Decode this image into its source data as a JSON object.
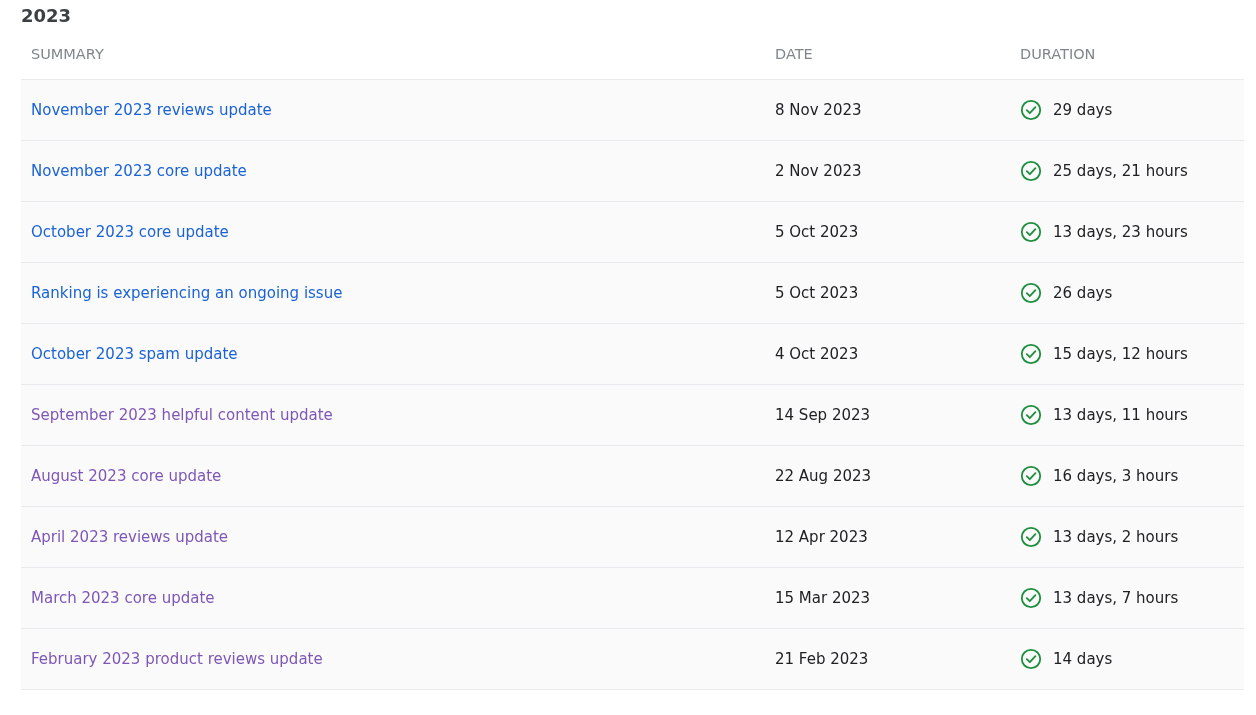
{
  "section": {
    "title": "2023"
  },
  "table": {
    "columns": [
      "SUMMARY",
      "DATE",
      "DURATION"
    ],
    "rows": [
      {
        "summary": "November 2023 reviews update",
        "visited": false,
        "date": "8 Nov 2023",
        "resolved": true,
        "duration": "29 days"
      },
      {
        "summary": "November 2023 core update",
        "visited": false,
        "date": "2 Nov 2023",
        "resolved": true,
        "duration": "25 days, 21 hours"
      },
      {
        "summary": "October 2023 core update",
        "visited": false,
        "date": "5 Oct 2023",
        "resolved": true,
        "duration": "13 days, 23 hours"
      },
      {
        "summary": "Ranking is experiencing an ongoing issue",
        "visited": false,
        "date": "5 Oct 2023",
        "resolved": true,
        "duration": "26 days"
      },
      {
        "summary": "October 2023 spam update",
        "visited": false,
        "date": "4 Oct 2023",
        "resolved": true,
        "duration": "15 days, 12 hours"
      },
      {
        "summary": "September 2023 helpful content update",
        "visited": true,
        "date": "14 Sep 2023",
        "resolved": true,
        "duration": "13 days, 11 hours"
      },
      {
        "summary": "August 2023 core update",
        "visited": true,
        "date": "22 Aug 2023",
        "resolved": true,
        "duration": "16 days, 3 hours"
      },
      {
        "summary": "April 2023 reviews update",
        "visited": true,
        "date": "12 Apr 2023",
        "resolved": true,
        "duration": "13 days, 2 hours"
      },
      {
        "summary": "March 2023 core update",
        "visited": true,
        "date": "15 Mar 2023",
        "resolved": true,
        "duration": "13 days, 7 hours"
      },
      {
        "summary": "February 2023 product reviews update",
        "visited": true,
        "date": "21 Feb 2023",
        "resolved": true,
        "duration": "14 days"
      }
    ]
  }
}
